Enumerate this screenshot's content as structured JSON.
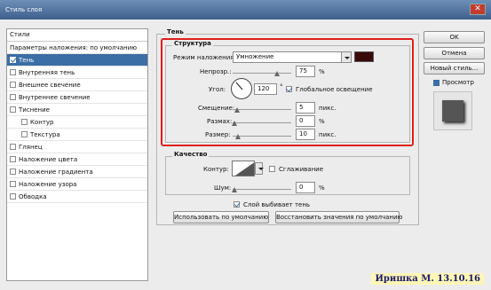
{
  "window": {
    "title": "Стиль слоя",
    "close_glyph": "✕"
  },
  "left_panel": {
    "header": "Стили",
    "items": [
      {
        "label": "Параметры наложения: по умолчанию",
        "checkbox": false,
        "checked": false,
        "sub": false,
        "selected": false
      },
      {
        "label": "Тень",
        "checkbox": true,
        "checked": true,
        "sub": false,
        "selected": true
      },
      {
        "label": "Внутренняя тень",
        "checkbox": true,
        "checked": false,
        "sub": false,
        "selected": false
      },
      {
        "label": "Внешнее свечение",
        "checkbox": true,
        "checked": false,
        "sub": false,
        "selected": false
      },
      {
        "label": "Внутреннее свечение",
        "checkbox": true,
        "checked": false,
        "sub": false,
        "selected": false
      },
      {
        "label": "Тиснение",
        "checkbox": true,
        "checked": false,
        "sub": false,
        "selected": false
      },
      {
        "label": "Контур",
        "checkbox": true,
        "checked": false,
        "sub": true,
        "selected": false
      },
      {
        "label": "Текстура",
        "checkbox": true,
        "checked": false,
        "sub": true,
        "selected": false
      },
      {
        "label": "Глянец",
        "checkbox": true,
        "checked": false,
        "sub": false,
        "selected": false
      },
      {
        "label": "Наложение цвета",
        "checkbox": true,
        "checked": false,
        "sub": false,
        "selected": false
      },
      {
        "label": "Наложение градиента",
        "checkbox": true,
        "checked": false,
        "sub": false,
        "selected": false
      },
      {
        "label": "Наложение узора",
        "checkbox": true,
        "checked": false,
        "sub": false,
        "selected": false
      },
      {
        "label": "Обводка",
        "checkbox": true,
        "checked": false,
        "sub": false,
        "selected": false
      }
    ]
  },
  "shadow": {
    "section_title": "Тень",
    "structure": {
      "title": "Структура",
      "blend_mode_label": "Режим наложения:",
      "blend_mode_value": "Умножение",
      "shadow_color": "#3a0a0a",
      "opacity_label": "Непрозр.:",
      "opacity_value": "75",
      "opacity_unit": "%",
      "opacity_fraction": 0.75,
      "angle_label": "Угол:",
      "angle_value": "120",
      "angle_unit": "°",
      "global_light_label": "Глобальное освещение",
      "global_light_checked": true,
      "distance_label": "Смещение:",
      "distance_value": "5",
      "distance_unit": "пикс.",
      "spread_label": "Размах:",
      "spread_value": "0",
      "spread_unit": "%",
      "size_label": "Размер:",
      "size_value": "10",
      "size_unit": "пикс."
    },
    "quality": {
      "title": "Качество",
      "contour_label": "Контур:",
      "antialias_label": "Сглаживание",
      "antialias_checked": false,
      "noise_label": "Шум:",
      "noise_value": "0",
      "noise_unit": "%"
    },
    "knockout_label": "Слой выбивает тень",
    "knockout_checked": true,
    "make_default_button": "Использовать по умолчанию",
    "reset_default_button": "Восстановить значения по умолчанию"
  },
  "right_buttons": {
    "ok": "OK",
    "cancel": "Отмена",
    "new_style": "Новый стиль...",
    "preview_label": "Просмотр",
    "preview_checked": true
  },
  "watermark": "Иришка М. 13.10.16",
  "accent_color": "#3a6ea5",
  "highlight_color": "#e0201b"
}
